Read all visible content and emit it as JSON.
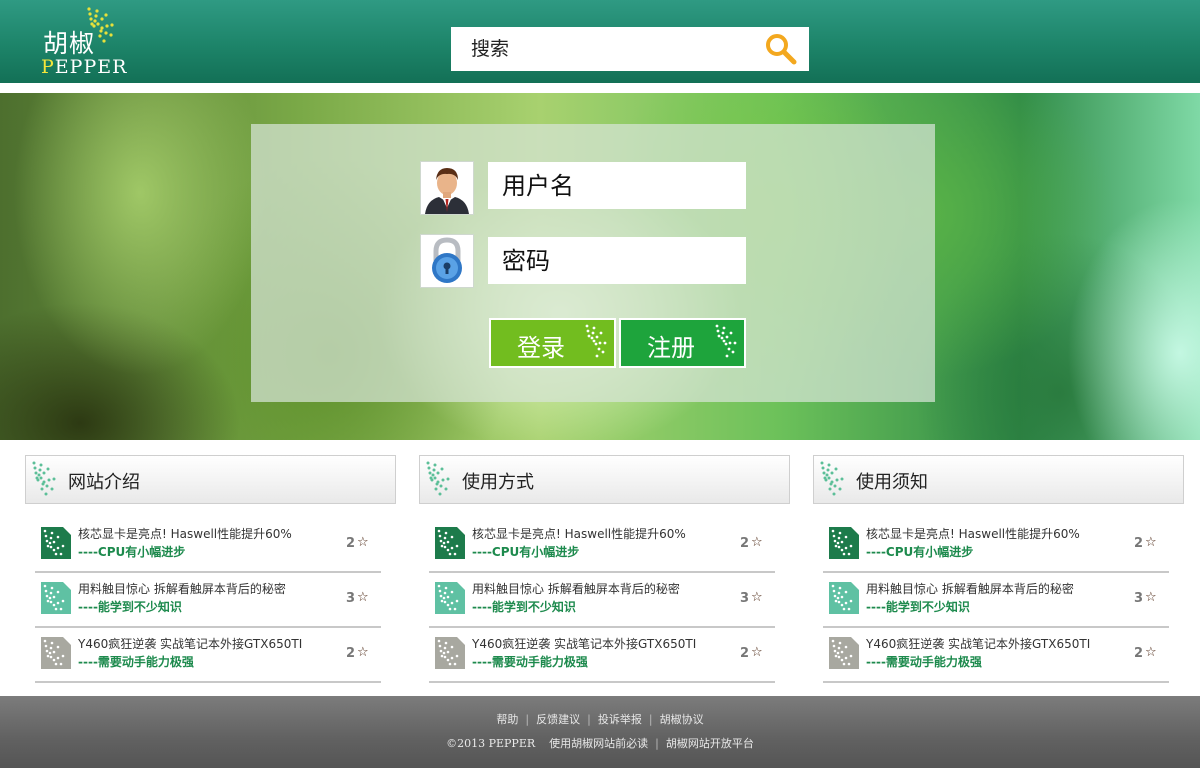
{
  "colors": {
    "header": "#1d8469",
    "login_button": "#72bd1f",
    "register_button": "#1ea43c",
    "accent_green": "#1d8a4d",
    "footer": "#616161"
  },
  "logo": {
    "cn": "胡椒",
    "en_first": "P",
    "en_rest": "EPPER"
  },
  "search": {
    "placeholder": "搜索",
    "icon": "search-icon"
  },
  "login": {
    "username_placeholder": "用户名",
    "password_placeholder": "密码",
    "user_icon": "user-avatar-icon",
    "lock_icon": "lock-icon",
    "login_label": "登录",
    "register_label": "注册"
  },
  "columns": [
    {
      "title": "网站介绍",
      "items": [
        {
          "title": "核芯显卡是亮点! Haswell性能提升60%",
          "sub": "----CPU有小幅进步",
          "count": "2",
          "icon_color": "#1d7b4b"
        },
        {
          "title": "用料触目惊心 拆解看触屏本背后的秘密",
          "sub": "----能学到不少知识",
          "count": "3",
          "icon_color": "#5fc1a3"
        },
        {
          "title": "Y460疯狂逆袭 实战笔记本外接GTX650TI",
          "sub": "----需要动手能力极强",
          "count": "2",
          "icon_color": "#a8a8a0"
        }
      ]
    },
    {
      "title": "使用方式",
      "items": [
        {
          "title": "核芯显卡是亮点! Haswell性能提升60%",
          "sub": "----CPU有小幅进步",
          "count": "2",
          "icon_color": "#1d7b4b"
        },
        {
          "title": "用料触目惊心 拆解看触屏本背后的秘密",
          "sub": "----能学到不少知识",
          "count": "3",
          "icon_color": "#5fc1a3"
        },
        {
          "title": "Y460疯狂逆袭 实战笔记本外接GTX650TI",
          "sub": "----需要动手能力极强",
          "count": "2",
          "icon_color": "#a8a8a0"
        }
      ]
    },
    {
      "title": "使用须知",
      "items": [
        {
          "title": "核芯显卡是亮点! Haswell性能提升60%",
          "sub": "----CPU有小幅进步",
          "count": "2",
          "icon_color": "#1d7b4b"
        },
        {
          "title": "用料触目惊心 拆解看触屏本背后的秘密",
          "sub": "----能学到不少知识",
          "count": "3",
          "icon_color": "#5fc1a3"
        },
        {
          "title": "Y460疯狂逆袭 实战笔记本外接GTX650TI",
          "sub": "----需要动手能力极强",
          "count": "2",
          "icon_color": "#a8a8a0"
        }
      ]
    }
  ],
  "star": "☆",
  "footer": {
    "links": [
      "帮助",
      "反馈建议",
      "投诉举报",
      "胡椒协议"
    ],
    "copyright": "©2013 PEPPER",
    "notice": "使用胡椒网站前必读",
    "platform": "胡椒网站开放平台"
  }
}
